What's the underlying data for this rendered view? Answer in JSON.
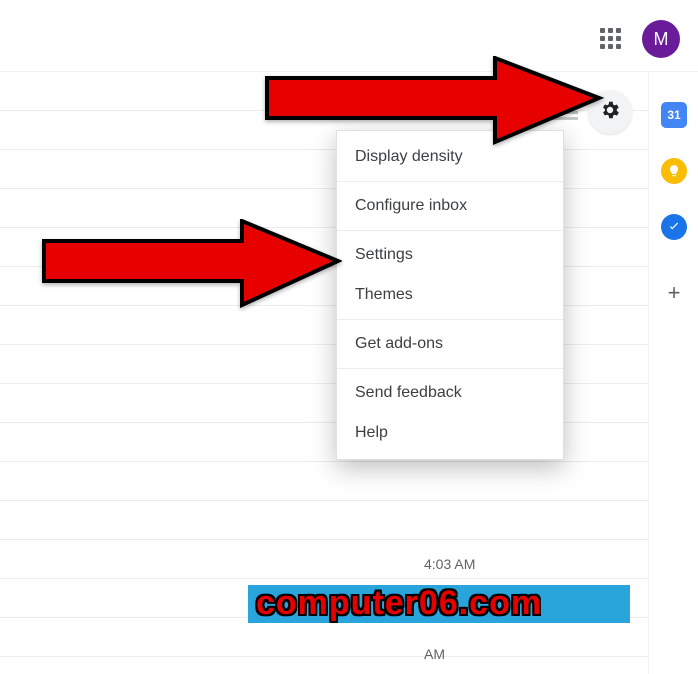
{
  "header": {
    "avatar_letter": "M"
  },
  "side_panel": {
    "calendar_label": "31"
  },
  "menu": {
    "items": [
      "Display density",
      "Configure inbox",
      "Settings",
      "Themes",
      "Get add-ons",
      "Send feedback",
      "Help"
    ]
  },
  "timestamps": {
    "t1": "4:03 AM",
    "t2": "AM"
  },
  "watermark": "computer06.com",
  "plus_glyph": "+"
}
